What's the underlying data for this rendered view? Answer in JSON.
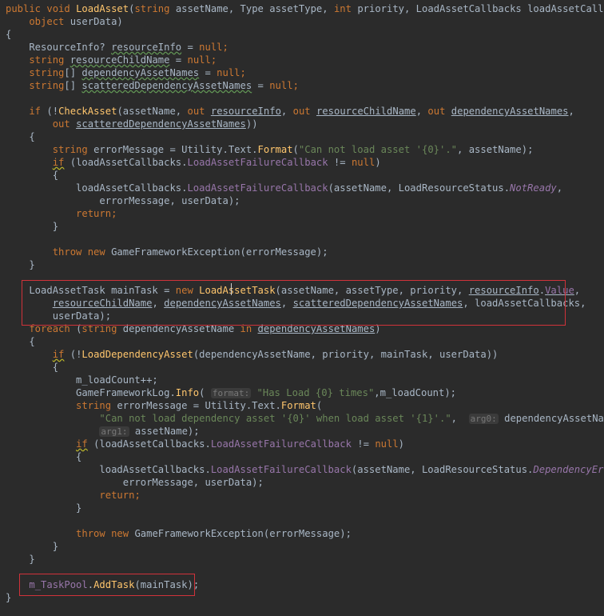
{
  "editor": {
    "lines": [
      [
        [
          "public void ",
          "kw"
        ],
        [
          "LoadAsset",
          "method"
        ],
        [
          "(",
          "plain"
        ],
        [
          "string ",
          "kw"
        ],
        [
          "assetName, Type assetType, ",
          "plain"
        ],
        [
          "int ",
          "kw"
        ],
        [
          "priority, LoadAssetCallbacks loadAssetCallbacks,",
          "plain"
        ]
      ],
      [
        [
          "    object ",
          "kw"
        ],
        [
          "userData)",
          "plain"
        ]
      ],
      [
        [
          "{",
          "plain"
        ]
      ],
      [
        [
          "    ResourceInfo? ",
          "plain"
        ],
        [
          "resourceInfo",
          "plain",
          "wavy"
        ],
        [
          " = ",
          "plain"
        ],
        [
          "null",
          "kw"
        ],
        [
          ";",
          "kw"
        ]
      ],
      [
        [
          "    string ",
          "kw"
        ],
        [
          "resourceChildName",
          "plain",
          "wavy"
        ],
        [
          " = ",
          "plain"
        ],
        [
          "null",
          "kw"
        ],
        [
          ";",
          "kw"
        ]
      ],
      [
        [
          "    string",
          "kw"
        ],
        [
          "[] ",
          "plain"
        ],
        [
          "dependencyAssetNames",
          "plain",
          "wavy"
        ],
        [
          " = ",
          "plain"
        ],
        [
          "null",
          "kw"
        ],
        [
          ";",
          "kw"
        ]
      ],
      [
        [
          "    string",
          "kw"
        ],
        [
          "[] ",
          "plain"
        ],
        [
          "scatteredDependencyAssetNames",
          "plain",
          "wavy"
        ],
        [
          " = ",
          "plain"
        ],
        [
          "null",
          "kw"
        ],
        [
          ";",
          "kw"
        ]
      ],
      [
        [
          "",
          "plain"
        ]
      ],
      [
        [
          "    if ",
          "kw"
        ],
        [
          "(!",
          "plain"
        ],
        [
          "CheckAsset",
          "method"
        ],
        [
          "(assetName, ",
          "plain"
        ],
        [
          "out ",
          "kw"
        ],
        [
          "resourceInfo",
          "plain",
          "u"
        ],
        [
          ", ",
          "plain"
        ],
        [
          "out ",
          "kw"
        ],
        [
          "resourceChildName",
          "plain",
          "u"
        ],
        [
          ", ",
          "plain"
        ],
        [
          "out ",
          "kw"
        ],
        [
          "dependencyAssetNames",
          "plain",
          "u"
        ],
        [
          ",",
          "plain"
        ]
      ],
      [
        [
          "        out ",
          "kw"
        ],
        [
          "scatteredDependencyAssetNames",
          "plain",
          "u"
        ],
        [
          "))",
          "plain"
        ]
      ],
      [
        [
          "    {",
          "plain"
        ]
      ],
      [
        [
          "        string ",
          "kw"
        ],
        [
          "errorMessage = Utility.Text.",
          "plain"
        ],
        [
          "Format",
          "method"
        ],
        [
          "(",
          "plain"
        ],
        [
          "\"Can not load asset '{0}'.\"",
          "str"
        ],
        [
          ", assetName);",
          "plain"
        ]
      ],
      [
        [
          "        ",
          "plain"
        ],
        [
          "if",
          "kw",
          "wavy-y"
        ],
        [
          " (loadAssetCallbacks.",
          "plain"
        ],
        [
          "LoadAssetFailureCallback",
          "field"
        ],
        [
          " != ",
          "plain"
        ],
        [
          "null",
          "kw"
        ],
        [
          ")",
          "plain"
        ]
      ],
      [
        [
          "        {",
          "plain"
        ]
      ],
      [
        [
          "            loadAssetCallbacks.",
          "plain"
        ],
        [
          "LoadAssetFailureCallback",
          "field"
        ],
        [
          "(assetName, LoadResourceStatus.",
          "plain"
        ],
        [
          "NotReady",
          "italic"
        ],
        [
          ",",
          "plain"
        ]
      ],
      [
        [
          "                errorMessage, userData);",
          "plain"
        ]
      ],
      [
        [
          "            return",
          "kw"
        ],
        [
          ";",
          "kw"
        ]
      ],
      [
        [
          "        }",
          "plain"
        ]
      ],
      [
        [
          "",
          "plain"
        ]
      ],
      [
        [
          "        throw new ",
          "kw"
        ],
        [
          "GameFrameworkException(errorMessage);",
          "plain"
        ]
      ],
      [
        [
          "    }",
          "plain"
        ]
      ],
      [
        [
          "",
          "plain"
        ]
      ],
      [
        [
          "    LoadAssetTask mainTask = ",
          "plain"
        ],
        [
          "new ",
          "kw"
        ],
        [
          "LoadAssetTask",
          "method"
        ],
        [
          "(assetName, assetType, priority, ",
          "plain"
        ],
        [
          "resourceInfo",
          "plain",
          "u"
        ],
        [
          ".",
          "plain"
        ],
        [
          "Value",
          "field",
          "u"
        ],
        [
          ",",
          "plain"
        ]
      ],
      [
        [
          "        ",
          "plain"
        ],
        [
          "resourceChildName",
          "plain",
          "u"
        ],
        [
          ", ",
          "plain"
        ],
        [
          "dependencyAssetNames",
          "plain",
          "u"
        ],
        [
          ", ",
          "plain"
        ],
        [
          "scatteredDependencyAssetNames",
          "plain",
          "u"
        ],
        [
          ", loadAssetCallbacks,",
          "plain"
        ]
      ],
      [
        [
          "        userData);",
          "plain"
        ]
      ],
      [
        [
          "    foreach ",
          "kw"
        ],
        [
          "(",
          "plain"
        ],
        [
          "string ",
          "kw"
        ],
        [
          "dependencyAssetName ",
          "plain"
        ],
        [
          "in ",
          "kw"
        ],
        [
          "dependencyAssetNames",
          "plain",
          "u"
        ],
        [
          ")",
          "plain"
        ]
      ],
      [
        [
          "    {",
          "plain"
        ]
      ],
      [
        [
          "        ",
          "plain"
        ],
        [
          "if",
          "kw",
          "wavy-y"
        ],
        [
          " (!",
          "plain"
        ],
        [
          "LoadDependencyAsset",
          "method"
        ],
        [
          "(dependencyAssetName, priority, mainTask, userData))",
          "plain"
        ]
      ],
      [
        [
          "        {",
          "plain"
        ]
      ],
      [
        [
          "            m_loadCount++;",
          "plain"
        ]
      ],
      [
        [
          "            GameFrameworkLog.",
          "plain"
        ],
        [
          "Info",
          "method"
        ],
        [
          "( ",
          "plain"
        ],
        [
          "format:",
          "hint"
        ],
        [
          " ",
          "plain"
        ],
        [
          "\"Has Load {0} times\"",
          "str"
        ],
        [
          ",m_loadCount);",
          "plain"
        ]
      ],
      [
        [
          "            string ",
          "kw"
        ],
        [
          "errorMessage = Utility.Text.",
          "plain"
        ],
        [
          "Format",
          "method"
        ],
        [
          "(",
          "plain"
        ]
      ],
      [
        [
          "                ",
          "plain"
        ],
        [
          "\"Can not load dependency asset '{0}' when load asset '{1}'.\"",
          "str"
        ],
        [
          ",  ",
          "plain"
        ],
        [
          "arg0:",
          "hint"
        ],
        [
          " dependencyAssetName,",
          "plain"
        ]
      ],
      [
        [
          "                ",
          "plain"
        ],
        [
          "arg1:",
          "hint"
        ],
        [
          " assetName);",
          "plain"
        ]
      ],
      [
        [
          "            ",
          "plain"
        ],
        [
          "if",
          "kw",
          "wavy-y"
        ],
        [
          " (loadAssetCallbacks.",
          "plain"
        ],
        [
          "LoadAssetFailureCallback",
          "field"
        ],
        [
          " != ",
          "plain"
        ],
        [
          "null",
          "kw"
        ],
        [
          ")",
          "plain"
        ]
      ],
      [
        [
          "            {",
          "plain"
        ]
      ],
      [
        [
          "                loadAssetCallbacks.",
          "plain"
        ],
        [
          "LoadAssetFailureCallback",
          "field"
        ],
        [
          "(assetName, LoadResourceStatus.",
          "plain"
        ],
        [
          "DependencyError",
          "italic"
        ],
        [
          ",",
          "plain"
        ]
      ],
      [
        [
          "                    errorMessage, userData);",
          "plain"
        ]
      ],
      [
        [
          "                return",
          "kw"
        ],
        [
          ";",
          "kw"
        ]
      ],
      [
        [
          "            }",
          "plain"
        ]
      ],
      [
        [
          "",
          "plain"
        ]
      ],
      [
        [
          "            throw new ",
          "kw"
        ],
        [
          "GameFrameworkException(errorMessage);",
          "plain"
        ]
      ],
      [
        [
          "        }",
          "plain"
        ]
      ],
      [
        [
          "    }",
          "plain"
        ]
      ],
      [
        [
          "",
          "plain"
        ]
      ],
      [
        [
          "    ",
          "plain"
        ],
        [
          "m_TaskPool",
          "field"
        ],
        [
          ".",
          "plain"
        ],
        [
          "AddTask",
          "method"
        ],
        [
          "(mainTask);",
          "plain"
        ]
      ],
      [
        [
          "}",
          "plain"
        ]
      ]
    ]
  },
  "colors": {
    "background": "#2b2b2b",
    "keyword": "#cc7832",
    "method": "#ffc66d",
    "string": "#6a8759",
    "field": "#9876aa",
    "plain": "#a9b7c6",
    "highlight_box": "#d0323a"
  }
}
